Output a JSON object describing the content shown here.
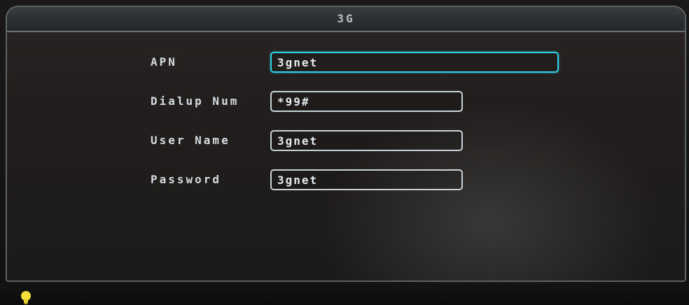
{
  "window": {
    "title": "3G"
  },
  "form": {
    "fields": [
      {
        "label": "APN",
        "value": "3gnet",
        "focused": true
      },
      {
        "label": "Dialup Num",
        "value": "*99#",
        "focused": false
      },
      {
        "label": "User Name",
        "value": "3gnet",
        "focused": false
      },
      {
        "label": "Password",
        "value": "3gnet",
        "focused": false
      }
    ]
  },
  "status": {
    "icon": "lightbulb-icon",
    "icon_color": "#f4e23a"
  },
  "colors": {
    "focus_border": "#2fd4e8",
    "field_border": "#c9d3d8"
  }
}
